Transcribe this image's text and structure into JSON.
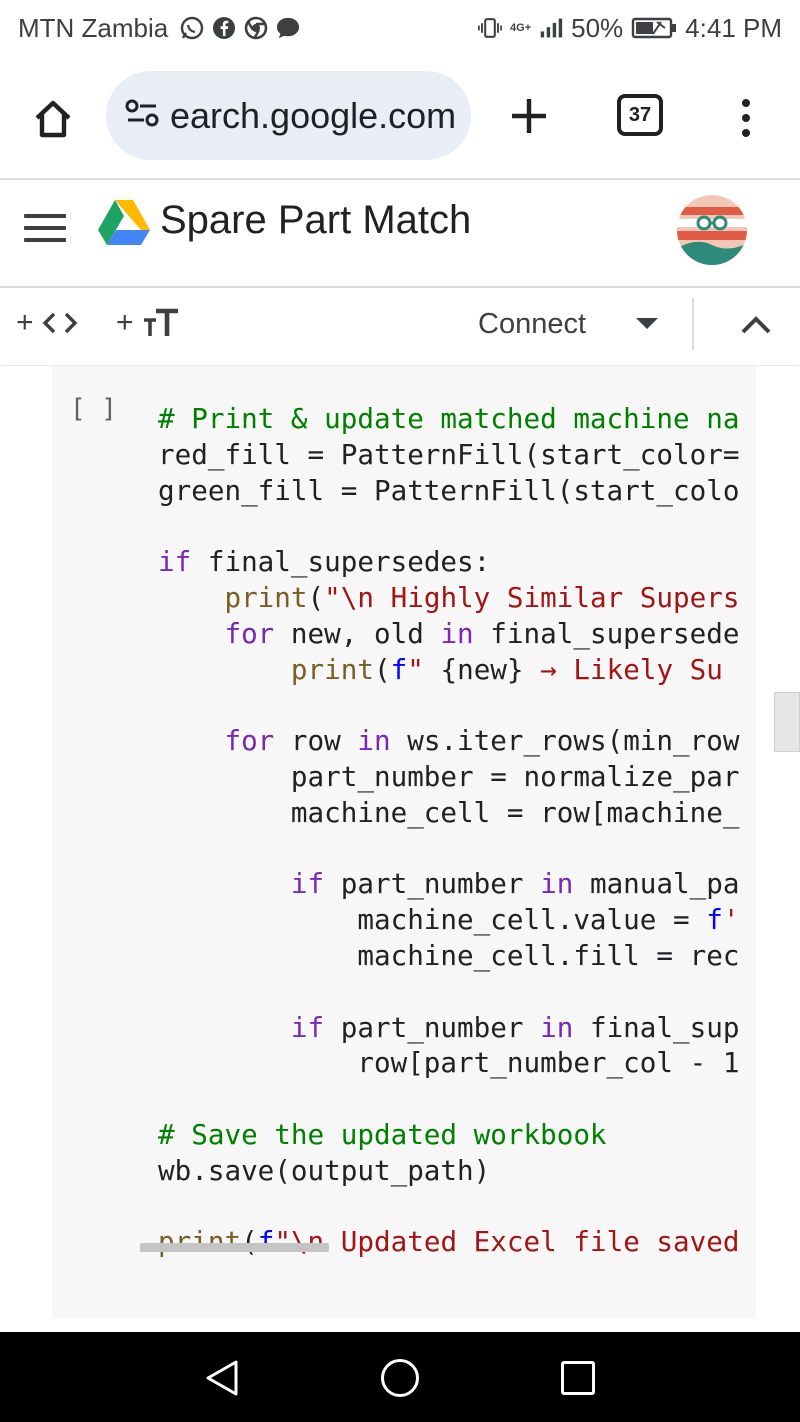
{
  "status_bar": {
    "carrier": "MTN Zambia",
    "notification_icons": [
      "whatsapp-business-icon",
      "facebook-icon",
      "chrome-icon",
      "messenger-icon"
    ],
    "network_label": "4G+",
    "battery_percent": "50%",
    "time": "4:41 PM"
  },
  "browser": {
    "url_display": "earch.google.com",
    "tab_count": "37",
    "icons": [
      "home-icon",
      "site-settings-icon",
      "new-tab-icon",
      "tab-switcher-icon",
      "overflow-menu-icon"
    ]
  },
  "app": {
    "title": "Spare Part Match",
    "brand_colors": {
      "drive_green": "#1ea362",
      "drive_yellow": "#ffba00",
      "drive_blue": "#4285f4"
    }
  },
  "toolbar": {
    "add_code_plus": "+",
    "add_text_plus": "+",
    "add_text_glyph": "TT",
    "connect_label": "Connect"
  },
  "cell": {
    "run_indicator": "[ ]",
    "code_lines": [
      [
        {
          "t": "# Print & update matched machine na",
          "c": "comment"
        }
      ],
      [
        {
          "t": "red_fill = PatternFill(start_color=",
          "c": "name"
        }
      ],
      [
        {
          "t": "green_fill = PatternFill(start_colo",
          "c": "name"
        }
      ],
      [],
      [
        {
          "t": "if",
          "c": "keyword"
        },
        {
          "t": " final_supersedes:",
          "c": "name"
        }
      ],
      [
        {
          "t": "    ",
          "c": "name"
        },
        {
          "t": "print",
          "c": "builtin"
        },
        {
          "t": "(",
          "c": "name"
        },
        {
          "t": "\"\\n Highly Similar Supers",
          "c": "string"
        }
      ],
      [
        {
          "t": "    ",
          "c": "name"
        },
        {
          "t": "for",
          "c": "keyword"
        },
        {
          "t": " new, old ",
          "c": "name"
        },
        {
          "t": "in",
          "c": "keyword"
        },
        {
          "t": " final_supersede",
          "c": "name"
        }
      ],
      [
        {
          "t": "        ",
          "c": "name"
        },
        {
          "t": "print",
          "c": "builtin"
        },
        {
          "t": "(",
          "c": "name"
        },
        {
          "t": "f",
          "c": "prefix"
        },
        {
          "t": "\" ",
          "c": "string"
        },
        {
          "t": "{new}",
          "c": "name"
        },
        {
          "t": " → Likely Su",
          "c": "string"
        }
      ],
      [],
      [
        {
          "t": "    ",
          "c": "name"
        },
        {
          "t": "for",
          "c": "keyword"
        },
        {
          "t": " row ",
          "c": "name"
        },
        {
          "t": "in",
          "c": "keyword"
        },
        {
          "t": " ws.iter_rows(min_row",
          "c": "name"
        }
      ],
      [
        {
          "t": "        part_number = normalize_par",
          "c": "name"
        }
      ],
      [
        {
          "t": "        machine_cell = row[machine_",
          "c": "name"
        }
      ],
      [],
      [
        {
          "t": "        ",
          "c": "name"
        },
        {
          "t": "if",
          "c": "keyword"
        },
        {
          "t": " part_number ",
          "c": "name"
        },
        {
          "t": "in",
          "c": "keyword"
        },
        {
          "t": " manual_pa",
          "c": "name"
        }
      ],
      [
        {
          "t": "            machine_cell.value = ",
          "c": "name"
        },
        {
          "t": "f",
          "c": "prefix"
        },
        {
          "t": "'",
          "c": "string"
        }
      ],
      [
        {
          "t": "            machine_cell.fill = rec",
          "c": "name"
        }
      ],
      [],
      [
        {
          "t": "        ",
          "c": "name"
        },
        {
          "t": "if",
          "c": "keyword"
        },
        {
          "t": " part_number ",
          "c": "name"
        },
        {
          "t": "in",
          "c": "keyword"
        },
        {
          "t": " final_sup",
          "c": "name"
        }
      ],
      [
        {
          "t": "            row[part_number_col - ",
          "c": "name"
        },
        {
          "t": "1",
          "c": "number"
        }
      ],
      [],
      [
        {
          "t": "# Save the updated workbook",
          "c": "comment"
        }
      ],
      [
        {
          "t": "wb.save(output_path)",
          "c": "name"
        }
      ],
      [],
      [
        {
          "t": "print",
          "c": "builtin"
        },
        {
          "t": "(",
          "c": "name"
        },
        {
          "t": "f",
          "c": "prefix"
        },
        {
          "t": "\"\\n Updated Excel file saved",
          "c": "string"
        }
      ]
    ]
  },
  "nav_bar": {
    "icons": [
      "back-icon",
      "home-icon",
      "recents-icon"
    ]
  }
}
